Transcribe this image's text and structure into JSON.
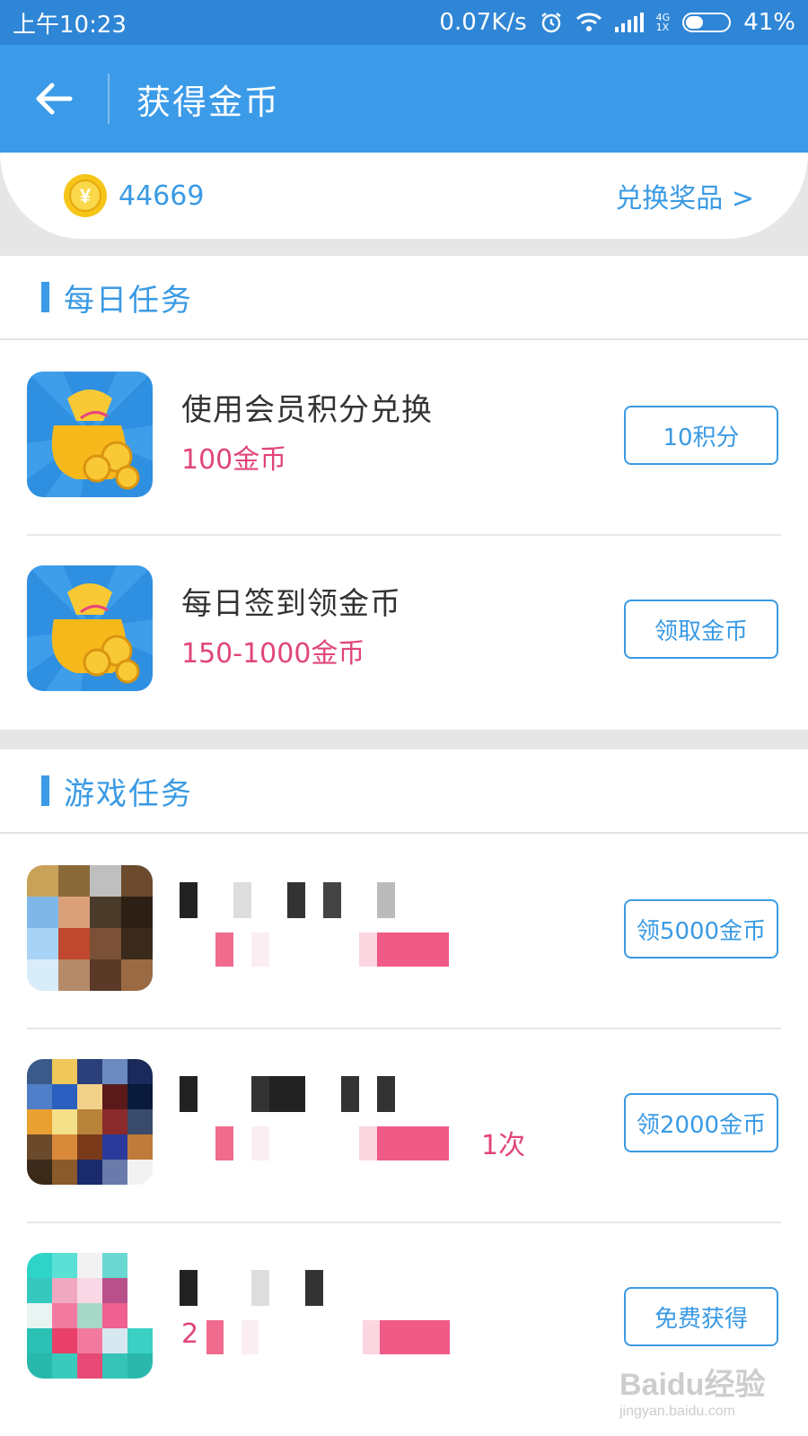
{
  "status_bar": {
    "time": "上午10:23",
    "net_speed": "0.07K/s",
    "net_type_top": "4G",
    "net_type_bottom": "1X",
    "battery": "41%",
    "battery_level": 0.41
  },
  "header": {
    "title": "获得金币",
    "back_icon": "arrow-left-icon"
  },
  "coins": {
    "amount": "44669",
    "exchange_label": "兑换奖品 >",
    "coin_icon": "coin-icon"
  },
  "daily_section": {
    "title": "每日任务",
    "tasks": [
      {
        "name": "使用会员积分兑换",
        "reward": "100金币",
        "button": "10积分",
        "icon": "money-bag-icon"
      },
      {
        "name": "每日签到领金币",
        "reward": "150-1000金币",
        "button": "领取金币",
        "icon": "money-bag-icon"
      }
    ]
  },
  "game_section": {
    "title": "游戏任务",
    "tasks": [
      {
        "name": "",
        "reward": "",
        "button": "领5000金币",
        "icon": "game-icon-warrior"
      },
      {
        "name": "",
        "reward": "1次",
        "button": "领2000金币",
        "icon": "game-icon-hero"
      },
      {
        "name": "",
        "reward": "2",
        "button": "免费获得",
        "icon": "game-icon-cartoon"
      }
    ]
  },
  "watermark": {
    "brand": "Baidu经验",
    "url": "jingyan.baidu.com"
  },
  "colors": {
    "status_bar": "#2f86d6",
    "app_bar": "#3b9be8",
    "accent": "#3a9ae4",
    "reward": "#e0457a",
    "background_band": "#e6e6e6"
  }
}
